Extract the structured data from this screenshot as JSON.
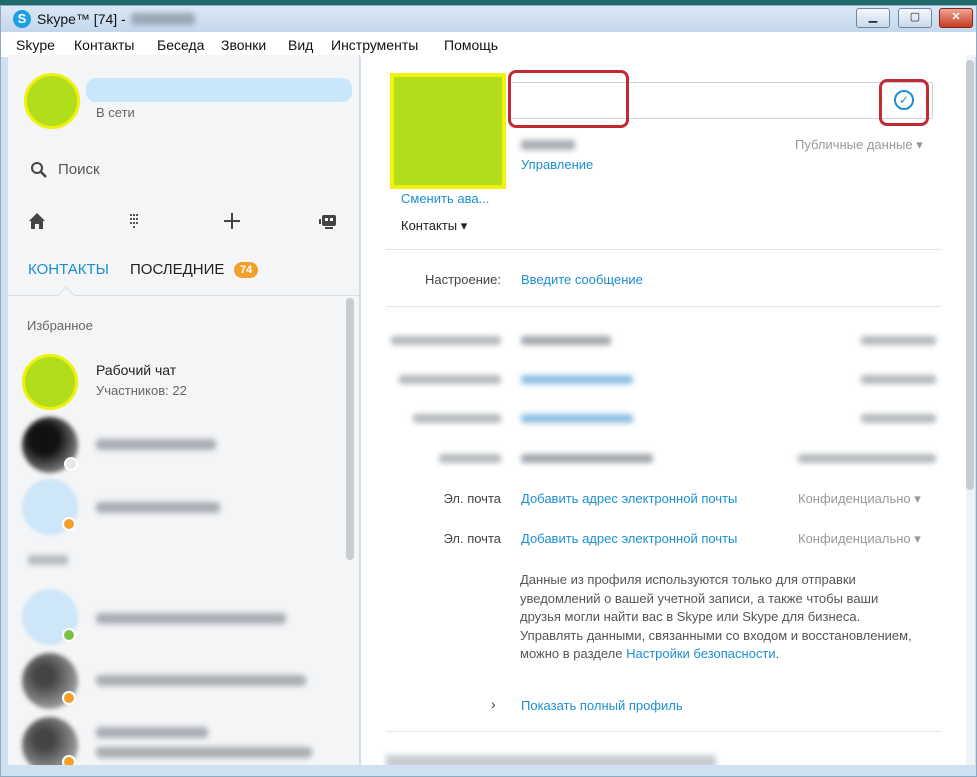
{
  "window": {
    "title": "Skype™ [74] -",
    "buttons": {
      "minimize": "▁",
      "maximize": "▢",
      "close": "✕"
    }
  },
  "menu": [
    "Skype",
    "Контакты",
    "Беседа",
    "Звонки",
    "Вид",
    "Инструменты",
    "Помощь"
  ],
  "left": {
    "status": "В сети",
    "search": "Поиск",
    "toolbar_icons": [
      "home-icon",
      "dialpad-icon",
      "add-icon",
      "bot-icon"
    ],
    "tabs": {
      "contacts": "КОНТАКТЫ",
      "recent": "ПОСЛЕДНИЕ",
      "recent_count": "74"
    },
    "favorites_label": "Избранное",
    "group_chat": {
      "name": "Рабочий чат",
      "members": "Участников: 22"
    }
  },
  "profile": {
    "change_avatar": "Сменить ава...",
    "contacts_dropdown": "Контакты ▾",
    "manage": "Управление",
    "public_data": "Публичные данные ▾",
    "mood_label": "Настроение:",
    "mood_link": "Введите сообщение",
    "email_rows": [
      {
        "label": "Эл. почта",
        "link": "Добавить адрес электронной почты",
        "privacy": "Конфиденциально ▾"
      },
      {
        "label": "Эл. почта",
        "link": "Добавить адрес электронной почты",
        "privacy": "Конфиденциально ▾"
      }
    ],
    "info_text": "Данные из профиля используются только для отправки уведомлений о вашей учетной записи, а также чтобы ваши друзья могли найти вас в Skype или Skype для бизнеса. Управлять данными, связанными со входом и восстановлением, можно в разделе",
    "info_link": "Настройки безопасности",
    "info_end": ".",
    "show_full_profile": "Показать полный профиль"
  },
  "colors": {
    "accent": "#1c8fd1",
    "avatar_fill": "#b1dd1b",
    "avatar_border": "#eef20c",
    "highlight": "#c22a33",
    "badge": "#f3a02a"
  }
}
